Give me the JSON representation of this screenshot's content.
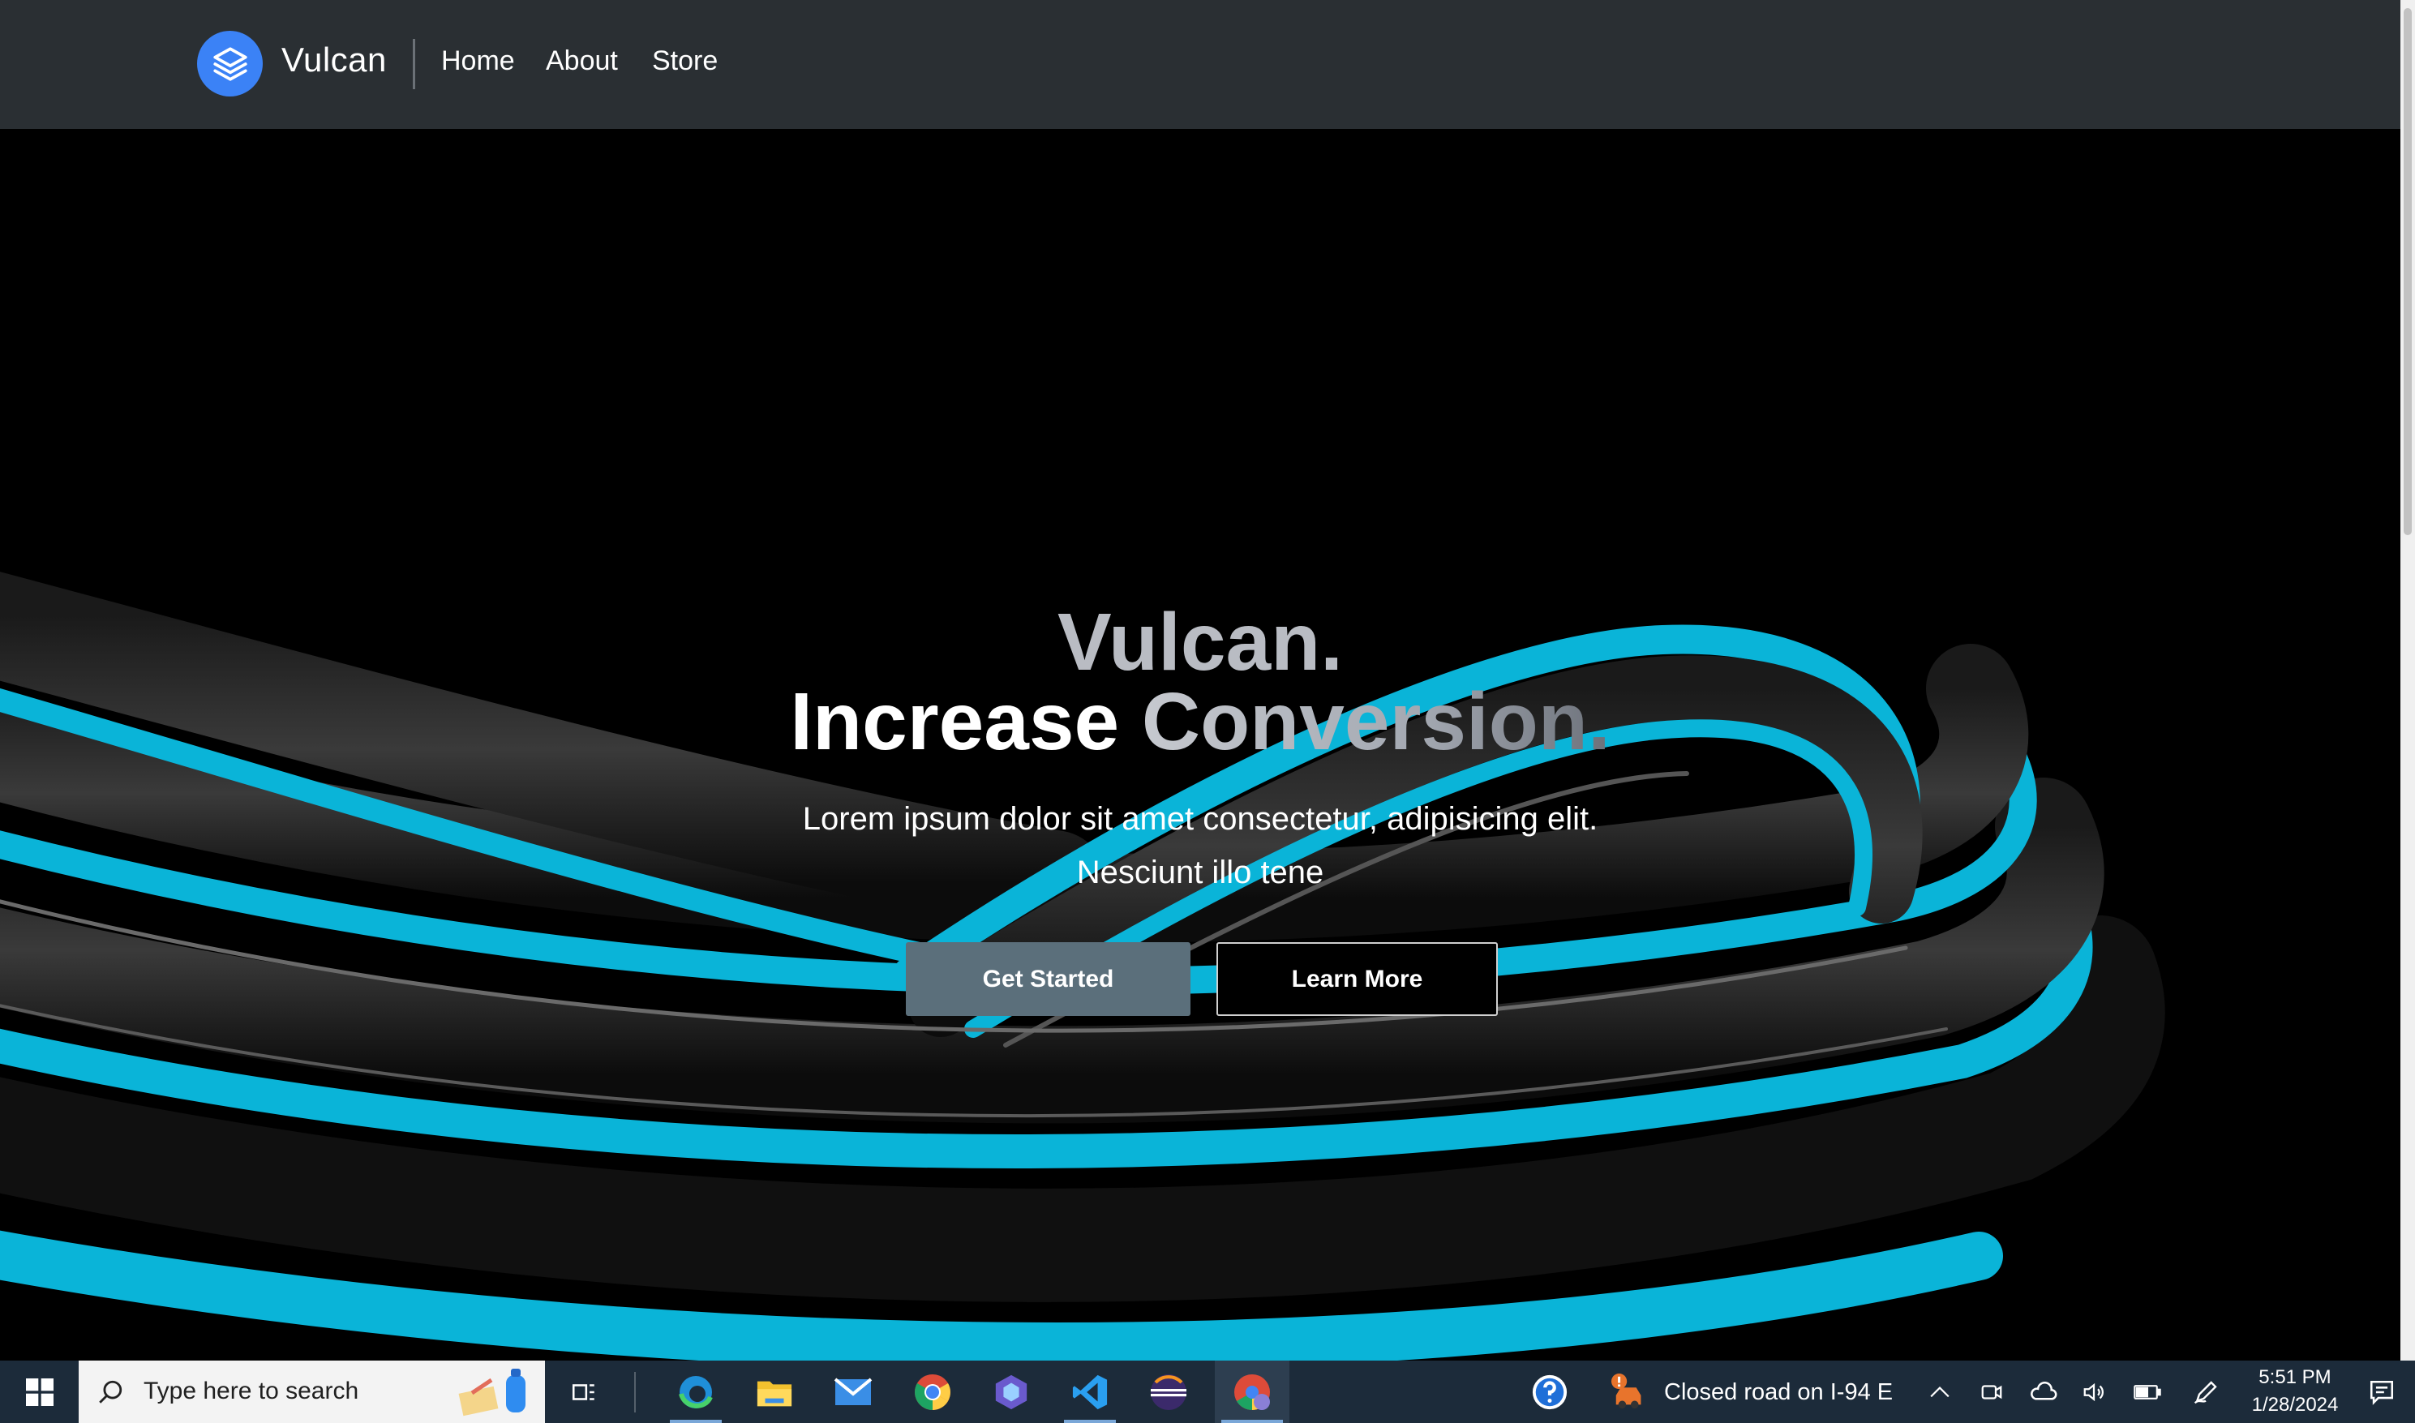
{
  "navbar": {
    "brand": "Vulcan",
    "links": [
      "Home",
      "About",
      "Store"
    ]
  },
  "hero": {
    "title_line1": "Vulcan.",
    "title_line2_part1": "Increase",
    "title_line2_part2": "Conversion.",
    "subtitle_line1": "Lorem ipsum dolor sit amet consectetur, adipisicing elit.",
    "subtitle_line2": "Nesciunt illo tene",
    "primary_button": "Get Started",
    "secondary_button": "Learn More"
  },
  "taskbar": {
    "search_placeholder": "Type here to search",
    "notification": "Closed road on I-94 E",
    "time": "5:51 PM",
    "date": "1/28/2024",
    "pinned_apps": [
      "edge-icon",
      "file-explorer-icon",
      "mail-icon",
      "chrome-icon",
      "copilot-icon",
      "vscode-icon",
      "eclipse-icon",
      "chrome-profile-icon"
    ]
  },
  "colors": {
    "navbar_bg": "#2a2f33",
    "logo_accent": "#3b82f6",
    "hero_bg": "#000000",
    "ribbon_accent": "#0ab4d8",
    "primary_button_bg": "#5b6f7b",
    "taskbar_bg": "#1c2b3a"
  }
}
